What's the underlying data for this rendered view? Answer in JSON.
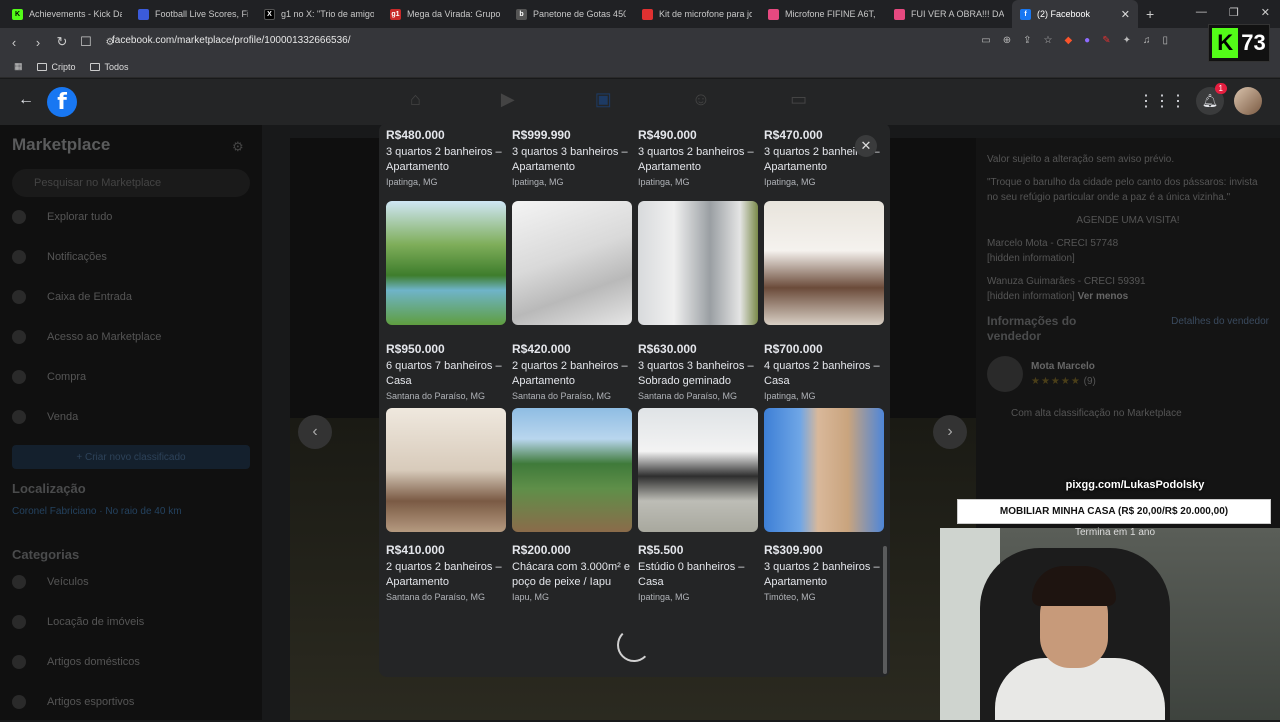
{
  "browser": {
    "tabs": [
      {
        "label": "Achievements - Kick Dash",
        "icon_color": "#53fc18",
        "icon": "K"
      },
      {
        "label": "Football Live Scores, Fixtu",
        "icon_color": "#3b5bdb",
        "icon": ""
      },
      {
        "label": "g1 no X: \"Trio de amigos c",
        "icon_color": "#000000",
        "icon": "X"
      },
      {
        "label": "Mega da Virada: Grupo de",
        "icon_color": "#c92a2a",
        "icon": "g1"
      },
      {
        "label": "Panetone de Gotas 450g |",
        "icon_color": "#555555",
        "icon": "b"
      },
      {
        "label": "Kit de microfone para jog",
        "icon_color": "#e03131",
        "icon": ""
      },
      {
        "label": "Microfone FIFINE A6T, Me",
        "icon_color": "#e64980",
        "icon": ""
      },
      {
        "label": "FUI VER A OBRA!!! DAQU",
        "icon_color": "#e64980",
        "icon": ""
      },
      {
        "label": "(2) Facebook",
        "icon_color": "#1877f2",
        "icon": "f"
      }
    ],
    "url": "facebook.com/marketplace/profile/100001332666536/",
    "bookmarks": [
      "Cripto",
      "Todos"
    ],
    "kick_count": "73"
  },
  "facebook": {
    "notification_count": "1"
  },
  "sidebar": {
    "title": "Marketplace",
    "search_placeholder": "Pesquisar no Marketplace",
    "items": [
      "Explorar tudo",
      "Notificações",
      "Caixa de Entrada",
      "Acesso ao Marketplace",
      "Compra",
      "Venda"
    ],
    "create_button": "+ Criar novo classificado",
    "location_heading": "Localização",
    "location_value": "Coronel Fabriciano · No raio de 40 km",
    "categories_heading": "Categorias",
    "categories": [
      "Veículos",
      "Locação de imóveis",
      "Artigos domésticos",
      "Artigos esportivos"
    ]
  },
  "right_pane": {
    "line1": "Valor sujeito a alteração sem aviso prévio.",
    "quote": "\"Troque o barulho da cidade pelo canto dos pássaros: invista no seu refúgio particular onde a paz é a única vizinha.\"",
    "cta": "AGENDE UMA VISITA!",
    "agent1": "Marcelo Mota - CRECI 57748",
    "hidden1": "[hidden information]",
    "agent2": "Wanuza Guimarães - CRECI 59391",
    "hidden2": "[hidden information]",
    "see_less": "Ver menos",
    "seller_heading": "Informações do vendedor",
    "seller_details": "Detalhes do vendedor",
    "seller_name": "Mota Marcelo",
    "rating_count": "(9)",
    "rating_note": "Com alta classificação no Marketplace"
  },
  "listings": [
    {
      "price": "R$480.000",
      "title": "3 quartos 2 banheiros – Apartamento",
      "location": "Ipatinga, MG",
      "has_image": false
    },
    {
      "price": "R$999.990",
      "title": "3 quartos 3 banheiros – Apartamento",
      "location": "Ipatinga, MG",
      "has_image": false
    },
    {
      "price": "R$490.000",
      "title": "3 quartos 2 banheiros – Apartamento",
      "location": "Ipatinga, MG",
      "has_image": false
    },
    {
      "price": "R$470.000",
      "title": "3 quartos 2 banheiros – Apartamento",
      "location": "Ipatinga, MG",
      "has_image": false
    },
    {
      "price": "R$950.000",
      "title": "6 quartos 7 banheiros – Casa",
      "location": "Santana do Paraíso, MG",
      "has_image": true
    },
    {
      "price": "R$420.000",
      "title": "2 quartos 2 banheiros – Apartamento",
      "location": "Santana do Paraíso, MG",
      "has_image": true
    },
    {
      "price": "R$630.000",
      "title": "3 quartos 3 banheiros – Sobrado geminado",
      "location": "Santana do Paraíso, MG",
      "has_image": true
    },
    {
      "price": "R$700.000",
      "title": "4 quartos 2 banheiros – Casa",
      "location": "Ipatinga, MG",
      "has_image": true
    },
    {
      "price": "R$410.000",
      "title": "2 quartos 2 banheiros – Apartamento",
      "location": "Santana do Paraíso, MG",
      "has_image": true
    },
    {
      "price": "R$200.000",
      "title": "Chácara com 3.000m² e poço de peixe / Iapu",
      "location": "Iapu, MG",
      "has_image": true
    },
    {
      "price": "R$5.500",
      "title": "Estúdio 0 banheiros – Casa",
      "location": "Ipatinga, MG",
      "has_image": true
    },
    {
      "price": "R$309.900",
      "title": "3 quartos 2 banheiros – Apartamento",
      "location": "Timóteo, MG",
      "has_image": true
    }
  ],
  "stream_overlay": {
    "donate_url": "pixgg.com/LukasPodolsky",
    "goal_text": "MOBILIAR MINHA CASA (R$ 20,00/R$ 20.000,00)",
    "goal_sub": "Termina em 1 ano"
  }
}
